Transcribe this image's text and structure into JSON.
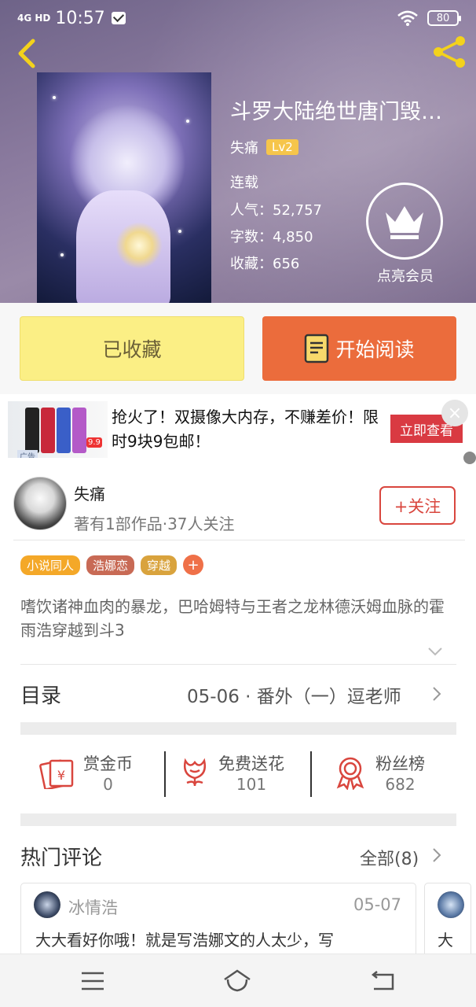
{
  "status_bar": {
    "network": "4G HD",
    "time": "10:57",
    "battery": "80"
  },
  "book": {
    "title": "斗罗大陆绝世唐门毁…",
    "author": "失痛",
    "level": "Lv2",
    "status": "连载",
    "popularity_label": "人气：",
    "popularity": "52,757",
    "words_label": "字数：",
    "words": "4,850",
    "favorites_label": "收藏：",
    "favorites": "656",
    "vip_label": "点亮会员"
  },
  "actions": {
    "collected": "已收藏",
    "start_reading": "开始阅读"
  },
  "ad": {
    "text": "抢火了！双摄像大内存，不赚差价！限时9块9包邮！",
    "button": "立即查看",
    "badge": "广告",
    "price_tag": "9.9",
    "close": "×"
  },
  "author_card": {
    "name": "失痛",
    "subtitle": "著有1部作品·37人关注",
    "follow": "+关注"
  },
  "tags": [
    {
      "label": "小说同人",
      "color": "#f4a828"
    },
    {
      "label": "浩娜恋",
      "color": "#c86a55"
    },
    {
      "label": "穿越",
      "color": "#d9a33d"
    }
  ],
  "tag_add": "+",
  "description": "嗜饮诸神血肉的暴龙，巴哈姆特与王者之龙林德沃姆血脉的霍雨浩穿越到斗3",
  "toc": {
    "label": "目录",
    "latest": "05-06 · 番外（一）逗老师"
  },
  "stats": [
    {
      "icon": "red-envelope-icon",
      "label": "赏金币",
      "value": "0"
    },
    {
      "icon": "flower-icon",
      "label": "免费送花",
      "value": "101"
    },
    {
      "icon": "medal-icon",
      "label": "粉丝榜",
      "value": "682"
    }
  ],
  "hot_comments": {
    "title": "热门评论",
    "all": "全部(8)",
    "items": [
      {
        "user": "冰情浩",
        "date": "05-07",
        "text": "大大看好你哦！就是写浩娜文的人太少，写"
      },
      {
        "text": "大"
      }
    ]
  },
  "colors": {
    "accent": "#eb6c3c",
    "collected": "#fbef85",
    "follow": "#d9463e"
  }
}
